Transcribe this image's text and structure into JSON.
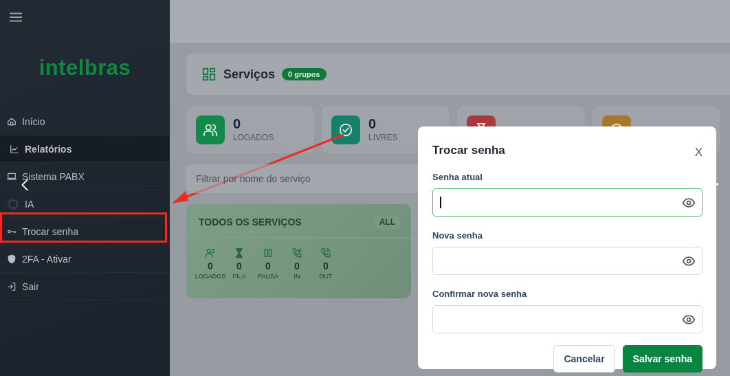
{
  "sidebar": {
    "logo": "intelbras",
    "items": [
      {
        "label": "Início",
        "selected": false
      },
      {
        "label": "Relatórios",
        "selected": true
      },
      {
        "label": "Sistema PABX",
        "selected": false
      },
      {
        "label": "IA",
        "selected": false
      },
      {
        "label": "Trocar senha",
        "selected": false
      },
      {
        "label": "2FA - Ativar",
        "selected": false
      },
      {
        "label": "Sair",
        "selected": false
      }
    ]
  },
  "header": {
    "title": "Serviços",
    "badge": "0 grupos"
  },
  "stats": [
    {
      "value": "0",
      "label": "LOGADOS",
      "color": "#128a4a"
    },
    {
      "value": "0",
      "label": "LIVRES",
      "color": "#16806a"
    },
    {
      "color": "#a8393f"
    },
    {
      "color": "#a8782a"
    }
  ],
  "filter": {
    "placeholder": "Filtrar por nome do serviço"
  },
  "group_card": {
    "title": "TODOS OS SERVIÇOS",
    "badge": "ALL",
    "metrics": [
      {
        "value": "0",
        "label": "LOGADOS"
      },
      {
        "value": "0",
        "label": "FILA"
      },
      {
        "value": "0",
        "label": "PAUSA"
      },
      {
        "value": "0",
        "label": "IN"
      },
      {
        "value": "0",
        "label": "OUT"
      }
    ]
  },
  "modal": {
    "title": "Trocar senha",
    "close": "X",
    "fields": [
      {
        "label": "Senha atual",
        "focused": true
      },
      {
        "label": "Nova senha",
        "focused": false
      },
      {
        "label": "Confirmar nova senha",
        "focused": false
      }
    ],
    "buttons": [
      {
        "label": "Cancelar",
        "kind": "secondary"
      },
      {
        "label": "Salvar senha",
        "kind": "primary"
      }
    ]
  }
}
